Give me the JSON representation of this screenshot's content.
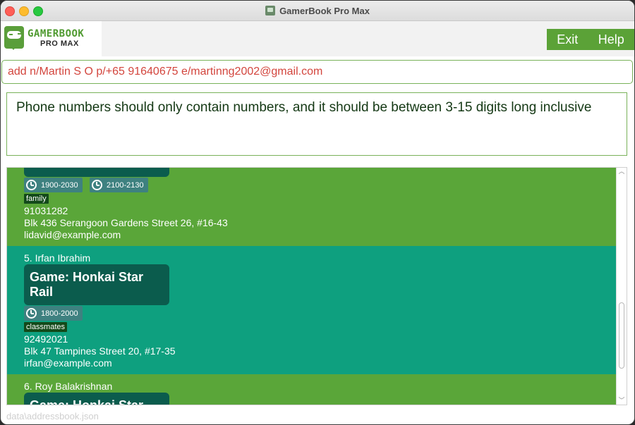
{
  "window": {
    "title": "GamerBook Pro Max"
  },
  "logo": {
    "line1": "GAMERBOOK",
    "line2": "PRO MAX"
  },
  "menu": {
    "exit": "Exit",
    "help": "Help"
  },
  "command": {
    "value": "add n/Martin S O p/+65 91640675 e/martinng2002@gmail.com"
  },
  "result": {
    "message": "Phone numbers should only contain numbers, and it should be between 3-15 digits long inclusive"
  },
  "persons": [
    {
      "slots": [
        "1900-2030",
        "2100-2130"
      ],
      "tag": "family",
      "phone": "91031282",
      "address": "Blk 436 Serangoon Gardens Street 26, #16-43",
      "email": "lidavid@example.com"
    },
    {
      "name": "5. Irfan Ibrahim",
      "game": "Game: Honkai Star Rail",
      "slots": [
        "1800-2000"
      ],
      "tag": "classmates",
      "phone": "92492021",
      "address": "Blk 47 Tampines Street 20, #17-35",
      "email": "irfan@example.com"
    },
    {
      "name": "6. Roy Balakrishnan",
      "game": "Game: Honkai Star Rail"
    }
  ],
  "status": {
    "path": "data\\addressbook.json"
  },
  "colors": {
    "accent_green": "#5aa639",
    "accent_teal": "#0ea07f",
    "error_text": "#d3453d"
  }
}
